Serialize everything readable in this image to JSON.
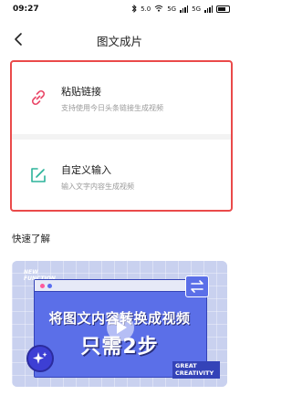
{
  "status_bar": {
    "time": "09:27",
    "network_label": "5G",
    "signal_1_label": "5G",
    "signal_2_label": "5G"
  },
  "nav": {
    "title": "图文成片"
  },
  "options": [
    {
      "title": "粘贴链接",
      "subtitle": "支持使用今日头条链接生成视频",
      "icon": "link-icon",
      "icon_color": "#ea4a6a"
    },
    {
      "title": "自定义输入",
      "subtitle": "输入文字内容生成视频",
      "icon": "edit-icon",
      "icon_color": "#2bb39a"
    }
  ],
  "highlight_color": "#ea4a4a",
  "section": {
    "title": "快速了解"
  },
  "video": {
    "tag": "NEW FUNCTION",
    "headline_line1": "将图文内容转换成视频",
    "headline_line2": "只需2步",
    "corner_tag": "GREAT CREATIVITY",
    "accent_color": "#5b6fe8"
  }
}
